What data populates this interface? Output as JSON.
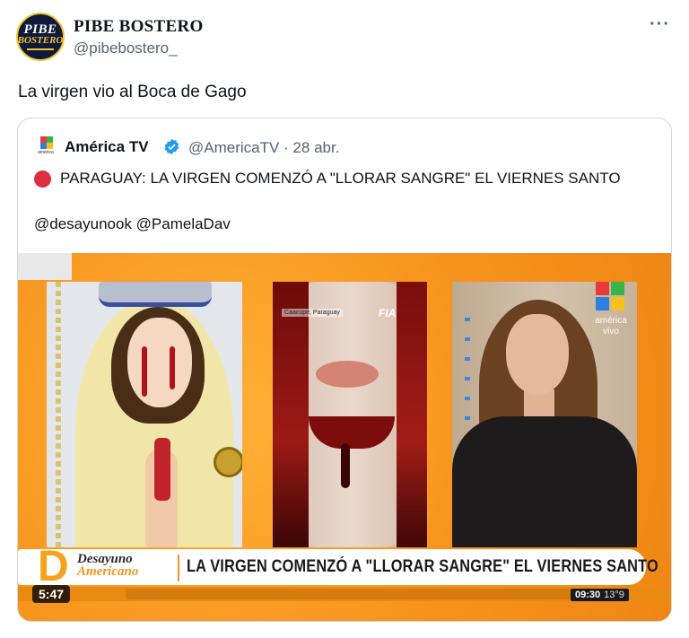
{
  "author": {
    "avatar_line1": "PIBE",
    "avatar_line2": "BOSTERO",
    "display_name": "PIBE BOSTERO",
    "handle": "@pibebostero_",
    "more_icon": "ellipsis-icon"
  },
  "tweet": {
    "text": "La virgen vio al Boca de Gago"
  },
  "quoted": {
    "logo_caption": "américa",
    "name": "América TV",
    "handle_date": "@AmericaTV · 28 abr.",
    "text": "PARAGUAY: LA VIRGEN COMENZÓ A \"LLORAR SANGRE\" EL VIERNES SANTO",
    "mentions": "@desayunook @PamelaDav",
    "colors": {
      "verified": "#1d9bf0",
      "red_circle": "#dd2e44",
      "border": "#cfd9de"
    }
  },
  "video": {
    "panel2_label": "Caacupé, Paraguay",
    "panel2_brand": "FIA",
    "panel3_logo_text": "américa vivo",
    "lower_d": "D",
    "lower_brand_1": "Desayuno",
    "lower_brand_2": "Americano",
    "headline": "LA VIRGEN COMENZÓ A \"LLORAR  SANGRE\" EL VIERNES SANTO",
    "duration": "5:47",
    "clock_time": "09:30",
    "clock_temp": "13°9",
    "colors": {
      "background": "#f79a1e",
      "accent": "#f7931c"
    }
  }
}
